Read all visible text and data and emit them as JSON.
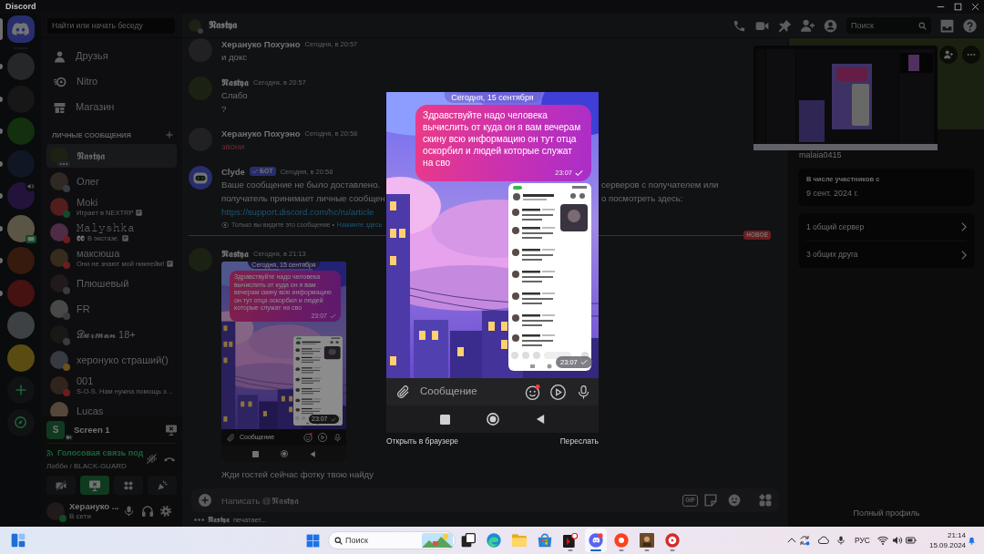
{
  "window": {
    "title": "Discord"
  },
  "rail": {
    "home": {
      "selected": true
    },
    "servers": [
      {
        "kind": "plain",
        "unread": true
      },
      {
        "kind": "plain",
        "unread": true
      },
      {
        "kind": "plain",
        "unread": true
      },
      {
        "kind": "plain",
        "unread": true
      },
      {
        "kind": "voice",
        "unread": true
      },
      {
        "kind": "screen",
        "unread": true
      },
      {
        "kind": "plain",
        "unread": true
      },
      {
        "kind": "plain",
        "unread": true
      },
      {
        "kind": "plain",
        "unread": false
      },
      {
        "kind": "plain",
        "unread": false
      }
    ]
  },
  "search": {
    "placeholder": "Найти или начать беседу"
  },
  "dm_nav": [
    {
      "label": "Друзья",
      "kind": "friends"
    },
    {
      "label": "Nitro",
      "kind": "nitro"
    },
    {
      "label": "Магазин",
      "kind": "shop"
    }
  ],
  "dm_section": {
    "title": "ЛИЧНЫЕ СООБЩЕНИЯ"
  },
  "dms": [
    {
      "name": "𝕹𝖆𝖘𝖙𝖞𝖆",
      "typing": true,
      "selected": true,
      "emoji": false,
      "activity_icon": false
    },
    {
      "name": "Олег",
      "color": "#3a3b40",
      "typing": false,
      "selected": false,
      "emoji": false,
      "activity_icon": false
    },
    {
      "name": "Moki",
      "activity": "Играет в NEXTRP",
      "color": "#104a28",
      "typing": false,
      "selected": false,
      "emoji": false,
      "activity_icon": true
    },
    {
      "name": "𝙼𝚊𝚕𝚢𝚜𝚑𝚔𝚊",
      "activity": "В экстазе.",
      "color": "#6d1c1e",
      "typing": false,
      "selected": false,
      "emoji": true,
      "activity_icon": true
    },
    {
      "name": "максюша",
      "activity": "Они не знают мой никнейм!",
      "color": "#6d1c1e",
      "typing": false,
      "selected": false,
      "emoji": false,
      "activity_icon": true
    },
    {
      "name": "Плюшевый",
      "color": "#3a3b40",
      "typing": false,
      "selected": false,
      "emoji": false,
      "activity_icon": false
    },
    {
      "name": "FR",
      "color": "#3a3b40",
      "typing": false,
      "selected": false,
      "emoji": false,
      "activity_icon": false
    },
    {
      "name": "𝓓𝓾𝓻𝓶𝓪𝓷 18+",
      "color": "#3a3b40",
      "typing": false,
      "selected": false,
      "emoji": false,
      "activity_icon": false
    },
    {
      "name": "херонуко страший()",
      "color": "#6c5016",
      "typing": false,
      "selected": false,
      "emoji": false,
      "activity_icon": false
    },
    {
      "name": "001",
      "activity": "S-O-S. Нам нужна помощь з…",
      "color": "#6d1c1e",
      "typing": false,
      "selected": false,
      "emoji": false,
      "activity_icon": false
    },
    {
      "name": "Lucas",
      "typing": false,
      "selected": false,
      "emoji": false,
      "activity_icon": false
    }
  ],
  "screen_share": {
    "tile": "S",
    "title": "Screen 1"
  },
  "voice": {
    "status": "Голосовая связь под",
    "channel": "Лобби / BLACK-GUARD",
    "buttons": [
      {
        "kind": "camera",
        "on": false
      },
      {
        "kind": "screen",
        "on": true
      },
      {
        "kind": "activities",
        "on": false
      },
      {
        "kind": "soundboard",
        "on": false
      }
    ]
  },
  "user": {
    "name": "Херануко ...",
    "status": "В сети",
    "color": "#104a28"
  },
  "chat_header": {
    "title": "𝕹𝖆𝖘𝖙𝖞𝖆",
    "color": "#3a3b40",
    "search_placeholder": "Поиск"
  },
  "messages": [
    {
      "kind": "text",
      "author": "Херануко Похуэно",
      "time": "Сегодня, в 20:57",
      "lines": [
        "и докс"
      ],
      "failed": false
    },
    {
      "kind": "text",
      "author": "𝕹𝖆𝖘𝖙𝖞𝖆",
      "time": "Сегодня, в 20:57",
      "lines": [
        "Слабо",
        "?"
      ],
      "failed": false
    },
    {
      "kind": "text",
      "author": "Херануко Похуэно",
      "time": "Сегодня, в 20:58",
      "lines": [
        "звони"
      ],
      "failed": true
    },
    {
      "kind": "system",
      "author": "Clyde",
      "tag": "БОТ",
      "time": "Сегодня, в 20:58",
      "split_lines": [
        {
          "left": "Ваше сообщение не было доставлено.",
          "right": "серверов с получателем или"
        },
        {
          "left": "получатель принимает личные сообщен",
          "right": "о посмотреть здесь:"
        }
      ],
      "link": "https://support.discord.com/hc/ru/article",
      "note": "Только вы видите это сообщение •",
      "note_link": "Нажмите здесь"
    },
    {
      "kind": "divider",
      "label": "НОВОЕ"
    },
    {
      "kind": "image",
      "author": "𝕹𝖆𝖘𝖙𝖞𝖆",
      "time": "Сегодня, в 21:13",
      "attachment": {
        "date": "Сегодня, 15 сентября",
        "message": "Здравствуйте надо человека вычислить от куда он я вам вечерам скину всю информацию он тут отца оскорбил и людей которые служат на сво",
        "time": "23:07",
        "sent": true,
        "inner_time": "23:07",
        "inner_sent": true,
        "placeholder": "Сообщение"
      }
    },
    {
      "kind": "continuation",
      "lines": [
        "Жди гостей сейчас фотку твою найду"
      ]
    }
  ],
  "composer": {
    "placeholder": "Написать @𝕹𝖆𝖘𝖙𝖞𝖆",
    "gif": "GIF"
  },
  "typing": {
    "name": "𝕹𝖆𝖘𝖙𝖞𝖆",
    "text": "печатает..."
  },
  "profile": {
    "username": "malaia0415",
    "member_since": {
      "title": "В числе участников с",
      "date": "9 сент. 2024 г."
    },
    "mutuals": [
      "1 общий сервер",
      "3 общих друга"
    ],
    "full_profile": "Полный профиль"
  },
  "lightbox": {
    "date": "Сегодня, 15 сентября",
    "message": "Здравствуйте надо человека вычислить от куда он я вам вечерам скину всю информацию он тут отца оскорбил и людей которые служат на сво",
    "time": "23:07",
    "sent": true,
    "inner_time": "23:07",
    "inner_sent": true,
    "placeholder": "Сообщение",
    "actions": [
      "Открыть в браузере",
      "Переслать"
    ]
  },
  "taskbar": {
    "search_placeholder": "Поиск",
    "apps": [
      {
        "kind": "taskview",
        "running": false,
        "selected": false
      },
      {
        "kind": "edge",
        "running": false,
        "selected": false
      },
      {
        "kind": "explorer",
        "running": false,
        "selected": false
      },
      {
        "kind": "store",
        "running": false,
        "selected": false
      },
      {
        "kind": "player",
        "running": true,
        "selected": false
      },
      {
        "kind": "discord",
        "running": true,
        "selected": true
      },
      {
        "kind": "yandex",
        "running": true,
        "selected": false
      },
      {
        "kind": "game",
        "running": true,
        "selected": false
      },
      {
        "kind": "recorder",
        "running": true,
        "selected": false
      }
    ],
    "language": "РУС",
    "time": "21:14",
    "date": "15.09.2024"
  }
}
